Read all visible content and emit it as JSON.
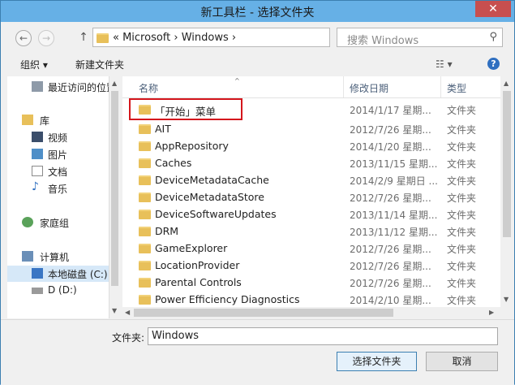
{
  "window": {
    "title": "新工具栏 - 选择文件夹",
    "close": "✕"
  },
  "nav": {
    "back": "←",
    "forward": "→",
    "up": "↑",
    "address": "«  Microsoft  ›  Windows  ›",
    "address_dropdown": "⌵",
    "refresh": "↻",
    "search_placeholder": "搜索 Windows",
    "search_icon": "⚲"
  },
  "toolbar": {
    "organize": "组织 ▾",
    "new_folder": "新建文件夹",
    "view": "☷ ▾",
    "help": "?"
  },
  "sidebar": {
    "items": [
      {
        "label": "最近访问的位置",
        "icon": "recent-places-icon"
      },
      {
        "label": "库",
        "icon": "libraries-icon"
      },
      {
        "label": "视频",
        "icon": "videos-icon"
      },
      {
        "label": "图片",
        "icon": "pictures-icon"
      },
      {
        "label": "文档",
        "icon": "documents-icon"
      },
      {
        "label": "音乐",
        "icon": "music-icon"
      },
      {
        "label": "家庭组",
        "icon": "homegroup-icon"
      },
      {
        "label": "计算机",
        "icon": "computer-icon"
      },
      {
        "label": "本地磁盘 (C:)",
        "icon": "drive-c-icon"
      },
      {
        "label": "D (D:)",
        "icon": "drive-d-icon"
      }
    ]
  },
  "columns": {
    "name": "名称",
    "date": "修改日期",
    "type": "类型"
  },
  "files": [
    {
      "name": "「开始」菜单",
      "date": "2014/1/17 星期...",
      "type": "文件夹"
    },
    {
      "name": "AIT",
      "date": "2012/7/26 星期...",
      "type": "文件夹"
    },
    {
      "name": "AppRepository",
      "date": "2014/1/20 星期...",
      "type": "文件夹"
    },
    {
      "name": "Caches",
      "date": "2013/11/15 星期...",
      "type": "文件夹"
    },
    {
      "name": "DeviceMetadataCache",
      "date": "2014/2/9 星期日 ...",
      "type": "文件夹"
    },
    {
      "name": "DeviceMetadataStore",
      "date": "2012/7/26 星期...",
      "type": "文件夹"
    },
    {
      "name": "DeviceSoftwareUpdates",
      "date": "2013/11/14 星期...",
      "type": "文件夹"
    },
    {
      "name": "DRM",
      "date": "2013/11/12 星期...",
      "type": "文件夹"
    },
    {
      "name": "GameExplorer",
      "date": "2012/7/26 星期...",
      "type": "文件夹"
    },
    {
      "name": "LocationProvider",
      "date": "2012/7/26 星期...",
      "type": "文件夹"
    },
    {
      "name": "Parental Controls",
      "date": "2012/7/26 星期...",
      "type": "文件夹"
    },
    {
      "name": "Power Efficiency Diagnostics",
      "date": "2014/2/10 星期...",
      "type": "文件夹"
    }
  ],
  "footer": {
    "folder_label": "文件夹:",
    "folder_value": "Windows",
    "select_button": "选择文件夹",
    "cancel_button": "取消"
  },
  "colors": {
    "titlebar": "#66b0e6",
    "highlight": "#d4161c",
    "folder": "#e8c05a"
  }
}
